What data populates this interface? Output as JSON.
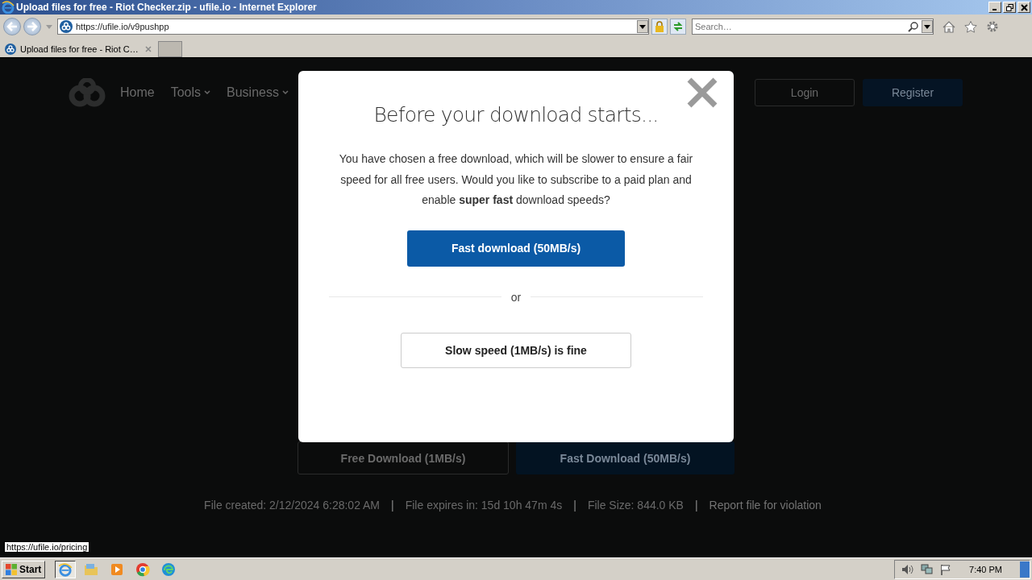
{
  "window": {
    "title": "Upload files for free - Riot Checker.zip - ufile.io - Internet Explorer"
  },
  "address_bar": {
    "url": "https://ufile.io/v9pushpp"
  },
  "search": {
    "placeholder": "Search…"
  },
  "tabs": [
    {
      "label": "Upload files for free - Riot C…",
      "selected": true
    }
  ],
  "site_nav": {
    "items": [
      {
        "label": "Home",
        "dropdown": false
      },
      {
        "label": "Tools",
        "dropdown": true
      },
      {
        "label": "Business",
        "dropdown": true
      }
    ],
    "login": "Login",
    "register": "Register"
  },
  "modal": {
    "title": "Before your download starts...",
    "body": "You have chosen a free download, which will be slower to ensure a fair speed for all free users. Would you like to subscribe to a paid plan and enable **super fast** download speeds?",
    "primary_button": "Fast download (50MB/s)",
    "divider_text": "or",
    "secondary_button": "Slow speed (1MB/s) is fine"
  },
  "download_buttons": [
    {
      "label": "Free Download (1MB/s)",
      "kind": "outline"
    },
    {
      "label": "Fast Download (50MB/s)",
      "kind": "primary"
    }
  ],
  "file_info": [
    {
      "text": "File created: 2/12/2024 6:28:02 AM",
      "kind": "text"
    },
    {
      "text": "|",
      "kind": "separator"
    },
    {
      "text": "File expires in: 15d 10h 47m 4s",
      "kind": "text"
    },
    {
      "text": "|",
      "kind": "separator"
    },
    {
      "text": "File Size: 844.0 KB",
      "kind": "text"
    },
    {
      "text": "|",
      "kind": "separator"
    },
    {
      "text": "Report file for violation",
      "kind": "link"
    }
  ],
  "status_url": "https://ufile.io/pricing",
  "taskbar": {
    "start": "Start",
    "apps": [
      {
        "kind": "ie",
        "selected": true
      },
      {
        "kind": "folder",
        "selected": false
      },
      {
        "kind": "media",
        "selected": false
      },
      {
        "kind": "chrome",
        "selected": false
      },
      {
        "kind": "edge",
        "selected": false
      }
    ],
    "clock": "7:40 PM"
  }
}
